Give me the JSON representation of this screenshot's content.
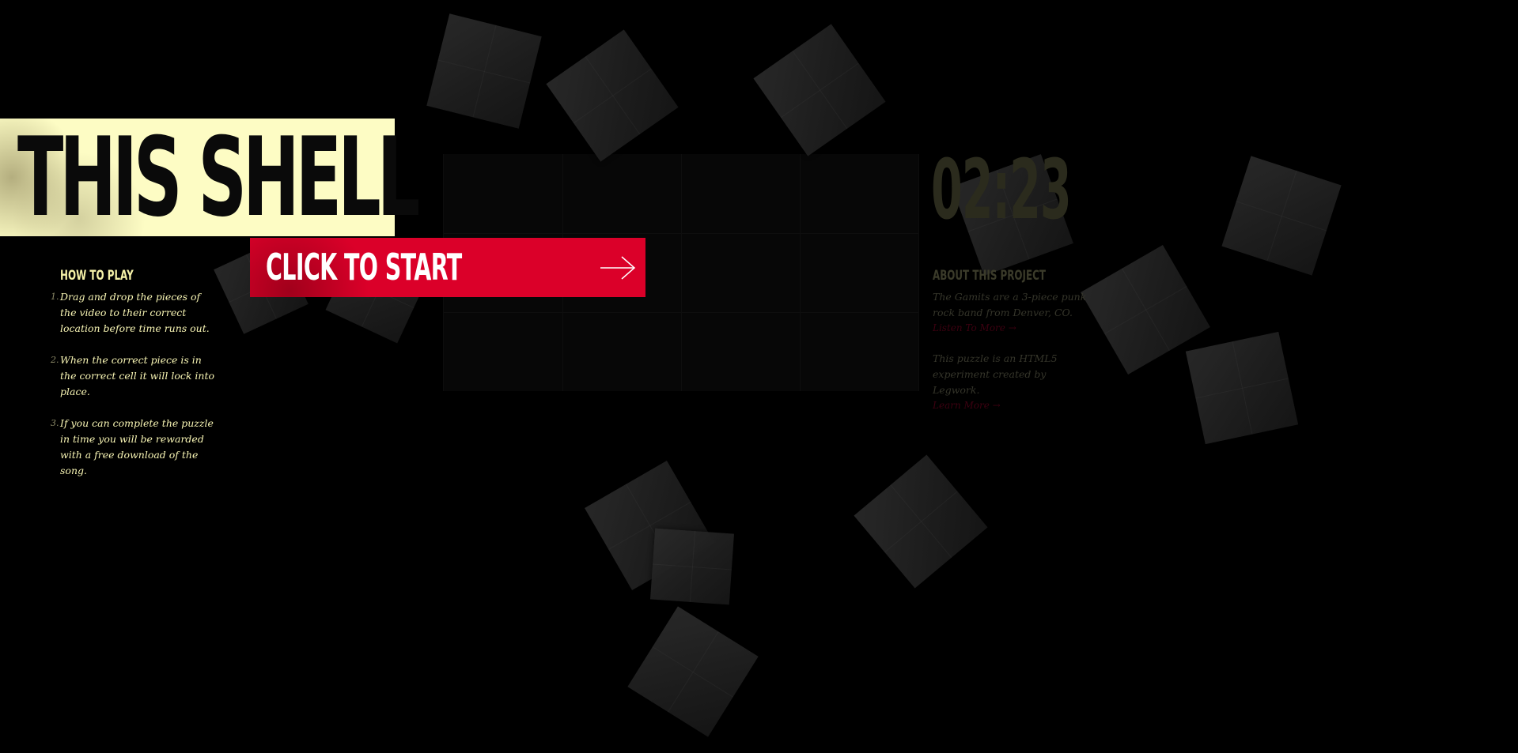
{
  "title": "THIS SHELL",
  "start_button": {
    "label": "CLICK TO START"
  },
  "how_to_play": {
    "heading": "HOW TO PLAY",
    "steps": [
      {
        "num": "1.",
        "text": "Drag and drop the pieces of the video to their correct location before time runs out."
      },
      {
        "num": "2.",
        "text": "When the correct piece is in the correct cell it will lock into place."
      },
      {
        "num": "3.",
        "text": "If you can complete the puzzle in time you will be rewarded with a free download of the song."
      }
    ]
  },
  "timer": "02:23",
  "about": {
    "heading": "ABOUT THIS PROJECT",
    "para1": "The Gamits are a 3-piece punk rock band from Denver, CO.",
    "link1": "Listen To More →",
    "para2": "This puzzle is an HTML5 experiment created by Legwork.",
    "link2": "Learn More →"
  },
  "colors": {
    "background": "#000000",
    "title_bg": "#fdfcc4",
    "button_red": "#db0029",
    "instruction_text": "#f8f5b4"
  },
  "icons": {
    "start_arrow": "arrow-right-icon"
  }
}
